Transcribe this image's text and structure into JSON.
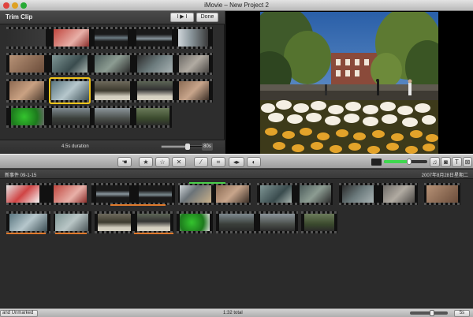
{
  "window": {
    "title": "iMovie – New Project 2"
  },
  "trim": {
    "title": "Trim Clip",
    "play_label": "I ▶ I",
    "done_label": "Done",
    "duration": "4.5s duration",
    "zoom_label": "80s",
    "zoom_level": 0.55
  },
  "toolbar": {
    "icons": [
      "hand-icon",
      "star-icon",
      "empty-star-icon",
      "reject-icon",
      "magic-wand-icon",
      "crop-icon",
      "audio-adjust-icon",
      "color-adjust-icon"
    ],
    "volume": 0.6,
    "right_icons": [
      "music-icon",
      "camera-icon",
      "title-icon",
      "transition-icon"
    ]
  },
  "event": {
    "name": "新事件 09-1-15",
    "date": "2007年8月28日星期二"
  },
  "status": {
    "filter": "and Unmarked",
    "total": "1:32 total",
    "zoom_label": "5s",
    "zoom_level": 0.6
  },
  "colors": {
    "selection": "#f2c51c",
    "used_marker": "#e07a2c",
    "favorite_marker": "#4ad04a",
    "volume": "#3fd84f"
  }
}
